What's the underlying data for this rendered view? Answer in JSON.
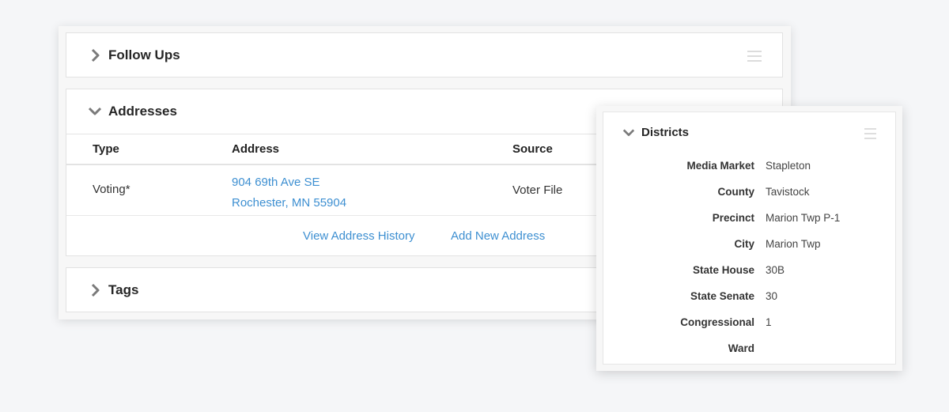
{
  "follow_ups": {
    "title": "Follow Ups"
  },
  "addresses": {
    "title": "Addresses",
    "columns": [
      "Type",
      "Address",
      "Source"
    ],
    "rows": [
      {
        "type": "Voting*",
        "address_line1": "904 69th Ave SE",
        "address_line2": "Rochester, MN 55904",
        "source": "Voter File"
      }
    ],
    "view_history_label": "View Address History",
    "add_new_label": "Add New Address"
  },
  "tags": {
    "title": "Tags"
  },
  "districts": {
    "title": "Districts",
    "rows": [
      {
        "label": "Media Market",
        "value": "Stapleton"
      },
      {
        "label": "County",
        "value": "Tavistock"
      },
      {
        "label": "Precinct",
        "value": "Marion Twp P-1"
      },
      {
        "label": "City",
        "value": "Marion Twp"
      },
      {
        "label": "State House",
        "value": "30B"
      },
      {
        "label": "State Senate",
        "value": "30"
      },
      {
        "label": "Congressional",
        "value": "1"
      },
      {
        "label": "Ward",
        "value": ""
      }
    ]
  },
  "colors": {
    "link": "#3d8fd1",
    "background": "#f5f6f8",
    "panel_border": "#e2e2e2"
  },
  "icons": {
    "collapsed": "chevron-right-icon",
    "expanded": "chevron-down-icon",
    "handle": "drag-handle-icon"
  }
}
